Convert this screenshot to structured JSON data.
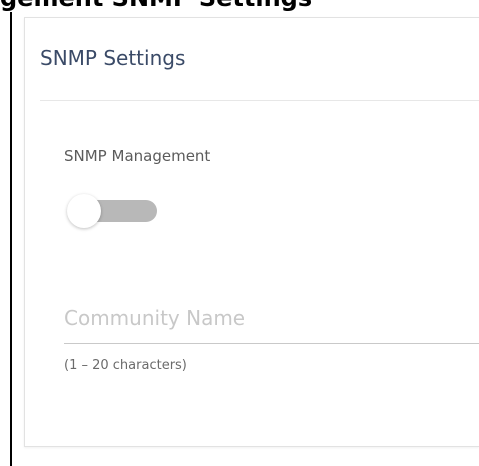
{
  "window": {
    "top_text": "gement   SNMP Settings"
  },
  "panel": {
    "title": "SNMP Settings"
  },
  "snmp_management": {
    "label": "SNMP Management",
    "enabled": false
  },
  "community_name": {
    "placeholder": "Community Name",
    "value": "",
    "helper": "(1 – 20 characters)"
  },
  "colors": {
    "title": "#3a4a67",
    "toggle_track": "#b8b8b8",
    "toggle_knob": "#ffffff",
    "placeholder": "#c8c8c8"
  },
  "icons": {
    "toggle": "switch-off-icon"
  }
}
